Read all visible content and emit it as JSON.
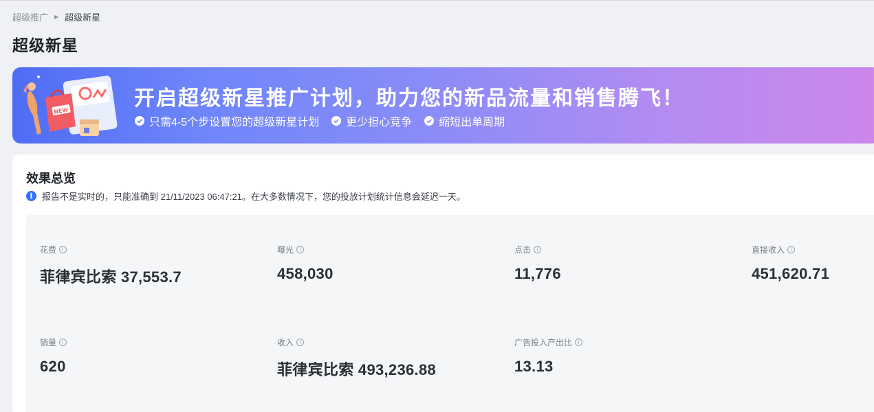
{
  "breadcrumb": {
    "parent": "超级推广",
    "current": "超级新星"
  },
  "page_title": "超级新星",
  "banner": {
    "title": "开启超级新星推广计划，助力您的新品流量和销售腾飞！",
    "points": [
      "只需4-5个步设置您的超级新星计划",
      "更少担心竞争",
      "缩短出单周期"
    ],
    "gradient_start": "#4f6cf5",
    "gradient_end": "#cd86ec",
    "illustration_icon": "shopping-bags-illustration"
  },
  "overview": {
    "title": "效果总览",
    "notice": "报告不是实时的，只能准确到 21/11/2023 06:47:21。在大多数情况下，您的投放计划统计信息会延迟一天。",
    "metrics": [
      {
        "label": "花费",
        "value": "菲律宾比索 37,553.7"
      },
      {
        "label": "曝光",
        "value": "458,030"
      },
      {
        "label": "点击",
        "value": "11,776"
      },
      {
        "label": "直接收入",
        "value": "451,620.71"
      },
      {
        "label": "销量",
        "value": "620"
      },
      {
        "label": "收入",
        "value": "菲律宾比索 493,236.88"
      },
      {
        "label": "广告投入产出比",
        "value": "13.13"
      }
    ]
  },
  "colors": {
    "accent": "#3370ff",
    "page_bg": "#f0f1f5"
  }
}
